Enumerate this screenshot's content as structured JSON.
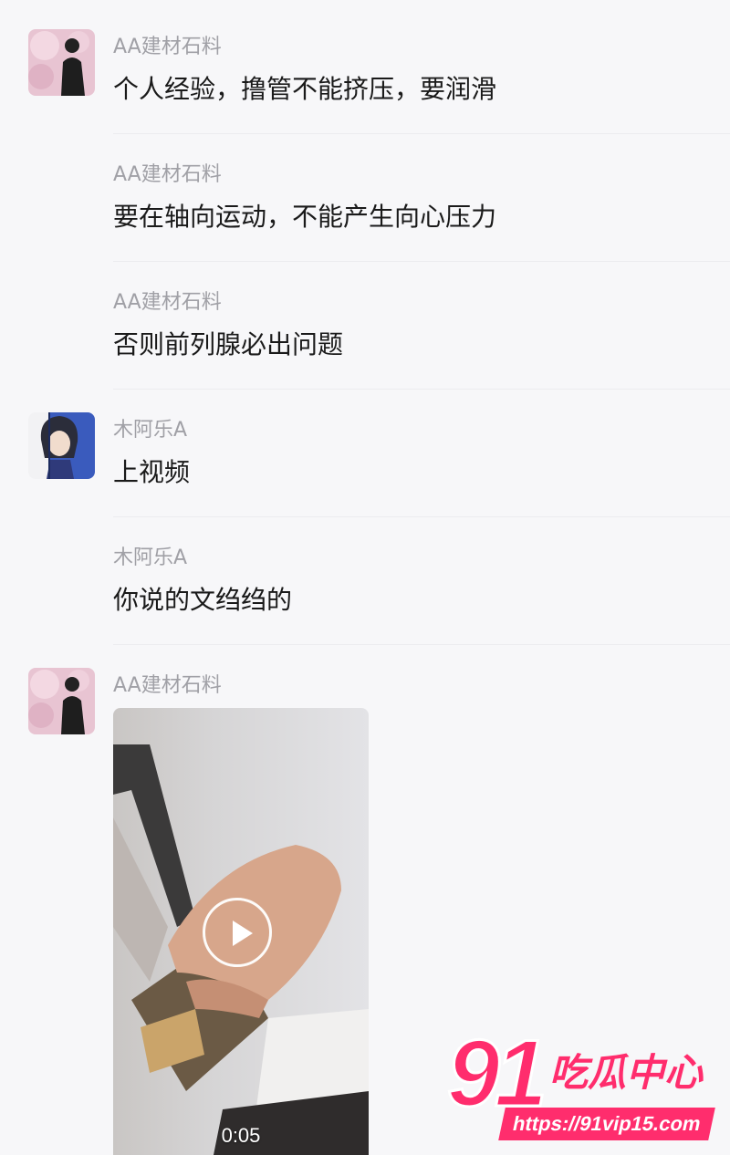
{
  "messages": [
    {
      "sender": "AA建材石料",
      "text": "个人经验，撸管不能挤压，要润滑"
    },
    {
      "sender": "AA建材石料",
      "text": "要在轴向运动，不能产生向心压力"
    },
    {
      "sender": "AA建材石料",
      "text": "否则前列腺必出问题"
    },
    {
      "sender": "木阿乐A",
      "text": "上视频"
    },
    {
      "sender": "木阿乐A",
      "text": "你说的文绉绉的"
    },
    {
      "sender": "AA建材石料",
      "video": {
        "duration": "0:05"
      }
    }
  ],
  "watermark": {
    "number": "91",
    "title": "吃瓜中心",
    "url": "https://91vip15.com"
  },
  "colors": {
    "background": "#f7f7f9",
    "sender": "#a0a0a6",
    "text": "#1a1a1a",
    "watermark": "#ff2d6d"
  },
  "icons": [
    "avatar-pink-sky-silhouette",
    "avatar-anime-boy",
    "play-icon"
  ]
}
